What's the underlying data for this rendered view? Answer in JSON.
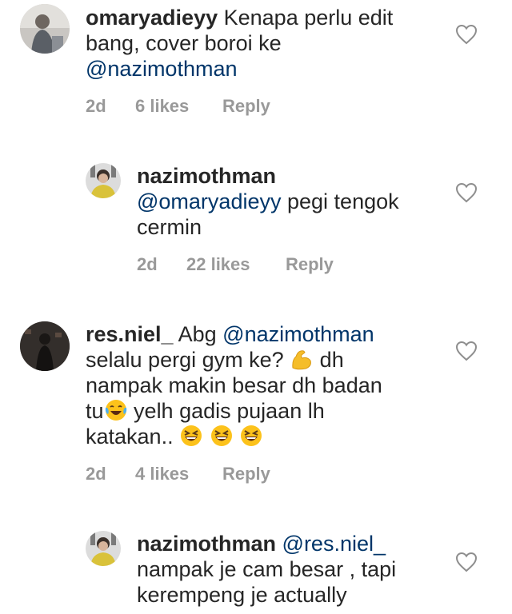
{
  "comments": [
    {
      "username": "omaryadieyy",
      "text_before": "Kenapa perlu edit bang,  cover boroi ke",
      "mention": "@nazimothman",
      "time": "2d",
      "likes": "6 likes",
      "reply_label": "Reply"
    },
    {
      "username": "nazimothman",
      "mention": "@omaryadieyy",
      "text_after": "pegi tengok cermin",
      "time": "2d",
      "likes": "22 likes",
      "reply_label": "Reply"
    },
    {
      "username": "res.niel_",
      "text_before": "Abg",
      "mention": "@nazimothman",
      "text_line2": "selalu pergi gym ke?",
      "text_line2b": "dh",
      "text_line3": "nampak makin besar dh badan",
      "text_line4a": "tu",
      "text_line4b": "yelh gadis pujaan lh",
      "text_line5": "katakan..",
      "time": "2d",
      "likes": "4 likes",
      "reply_label": "Reply"
    },
    {
      "username": "nazimothman",
      "mention": "@res.niel_",
      "text_line2": "nampak je cam besar , tapi",
      "text_line3": "kerempeng je actually"
    }
  ],
  "icons": {
    "like": "heart-outline-icon",
    "emoji_flex": "flexed-biceps-emoji",
    "emoji_laugh_cry": "tears-of-joy-emoji",
    "emoji_grin": "grinning-squinting-emoji"
  },
  "colors": {
    "mention": "#003569",
    "meta": "#999999",
    "text": "#262626"
  }
}
